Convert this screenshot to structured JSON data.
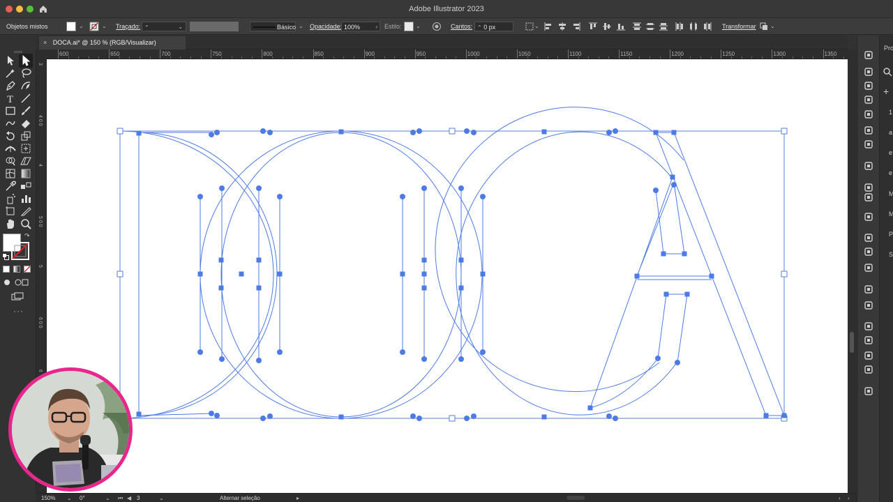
{
  "window": {
    "title": "Adobe Illustrator 2023"
  },
  "control_bar": {
    "selection_type": "Objetos mistos",
    "stroke_label": "Traçado:",
    "brush_label": "Básico",
    "opacity_label": "Opacidade:",
    "opacity_value": "100%",
    "style_label": "Estilo:",
    "corners_label": "Cantos:",
    "corners_value": "0 px",
    "transform_label": "Transformar"
  },
  "document_tab": {
    "title": "DOCA.ai* @ 150 % (RGB/Visualizar)",
    "close_glyph": "×"
  },
  "ruler": {
    "horizontal_ticks": [
      "600",
      "650",
      "700",
      "750",
      "800",
      "850",
      "900",
      "950",
      "1000",
      "1050",
      "1100",
      "1150",
      "1200",
      "1250",
      "1300",
      "1350"
    ],
    "vertical_ticks": [
      "3",
      "4 0 0",
      "4",
      "5 0 0",
      "5",
      "6 0 0",
      "6"
    ]
  },
  "right_panel_partial_labels": [
    "Pro",
    "1",
    "a",
    "e",
    "e",
    "M",
    "M",
    "P",
    "S"
  ],
  "status_bar": {
    "zoom": "150%",
    "rotation": "0°",
    "artboard_number": "3",
    "status_text": "Alternar seleção"
  },
  "colors": {
    "path_blue": "#4d7be6",
    "selection_blue": "#5a7ed8",
    "ui_dark": "#323232",
    "webcam_border": "#e8268c"
  },
  "icons": [
    "home-icon",
    "selection-tool-icon",
    "direct-selection-tool-icon",
    "magic-wand-icon",
    "lasso-icon",
    "pen-tool-icon",
    "curvature-icon",
    "type-tool-icon",
    "line-tool-icon",
    "rectangle-tool-icon",
    "paintbrush-icon",
    "shaper-icon",
    "eraser-icon",
    "rotate-icon",
    "scale-icon",
    "width-icon",
    "free-transform-icon",
    "shape-builder-icon",
    "perspective-icon",
    "mesh-icon",
    "gradient-icon",
    "eyedropper-icon",
    "blend-icon",
    "symbol-sprayer-icon",
    "graph-icon",
    "artboard-icon",
    "slice-icon",
    "hand-icon",
    "zoom-icon"
  ]
}
